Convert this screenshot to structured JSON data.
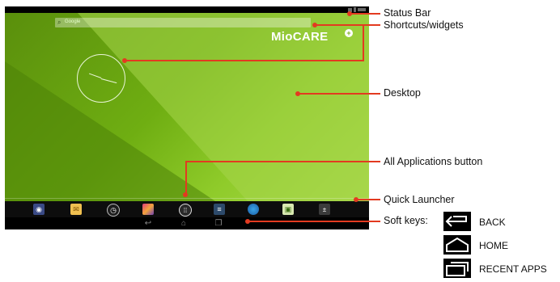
{
  "device": {
    "search_hint": "Google",
    "brand": "MioCARE",
    "brand_mark": "+"
  },
  "dock": {
    "icons": [
      "camera-icon",
      "email-icon",
      "clock-icon",
      "gallery-icon",
      "all-apps-icon",
      "settings-icon",
      "browser-icon",
      "launcher-icon",
      "calculator-icon"
    ]
  },
  "navbar": {
    "keys": [
      "back-key-icon",
      "home-key-icon",
      "recent-apps-key-icon"
    ]
  },
  "callouts": {
    "status_bar": "Status Bar",
    "shortcuts": "Shortcuts/widgets",
    "desktop": "Desktop",
    "all_apps": "All Applications button",
    "quick_launcher": "Quick Launcher",
    "soft_keys": "Soft keys:"
  },
  "softkeys": {
    "back": "BACK",
    "home": "HOME",
    "recent": "RECENT APPS"
  },
  "colors": {
    "accent": "#e33a20",
    "wallpaper": "#6fae12"
  }
}
